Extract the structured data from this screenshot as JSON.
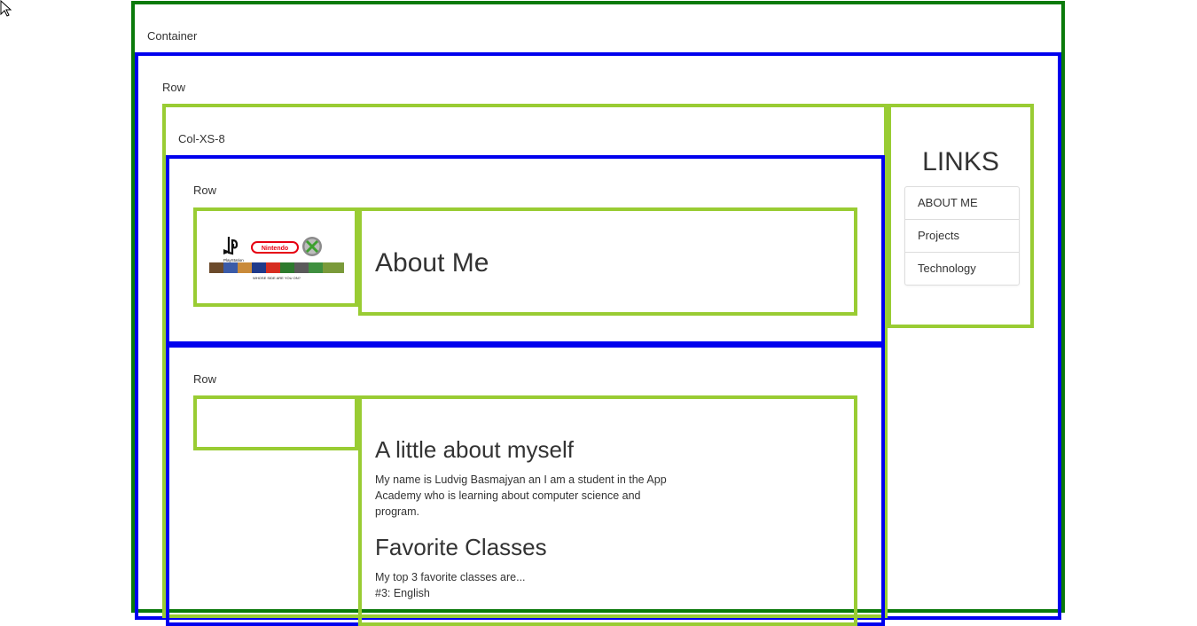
{
  "labels": {
    "container": "Container",
    "row_outer": "Row",
    "col": "Col-XS-8",
    "row_top": "Row",
    "row_bottom": "Row"
  },
  "hero": {
    "title": "About Me",
    "logo_text": {
      "playstation": "PlayStation",
      "nintendo": "Nintendo",
      "tagline": "WHOSE SIDE ARE YOU ON?"
    }
  },
  "content": {
    "section1_title": "A little about myself",
    "section1_text": "My name is Ludvig Basmajyan an I am a student in the App Academy who is learning about computer science and program.",
    "section2_title": "Favorite Classes",
    "section2_line1": "My top 3 favorite classes are...",
    "section2_line2": "#3: English"
  },
  "sidebar": {
    "title": "LINKS",
    "items": [
      {
        "label": "ABOUT ME"
      },
      {
        "label": "Projects"
      },
      {
        "label": "Technology"
      }
    ]
  },
  "colors": {
    "container_border": "#0a7a0a",
    "row_border": "#0000ee",
    "col_border": "#99cc33"
  }
}
